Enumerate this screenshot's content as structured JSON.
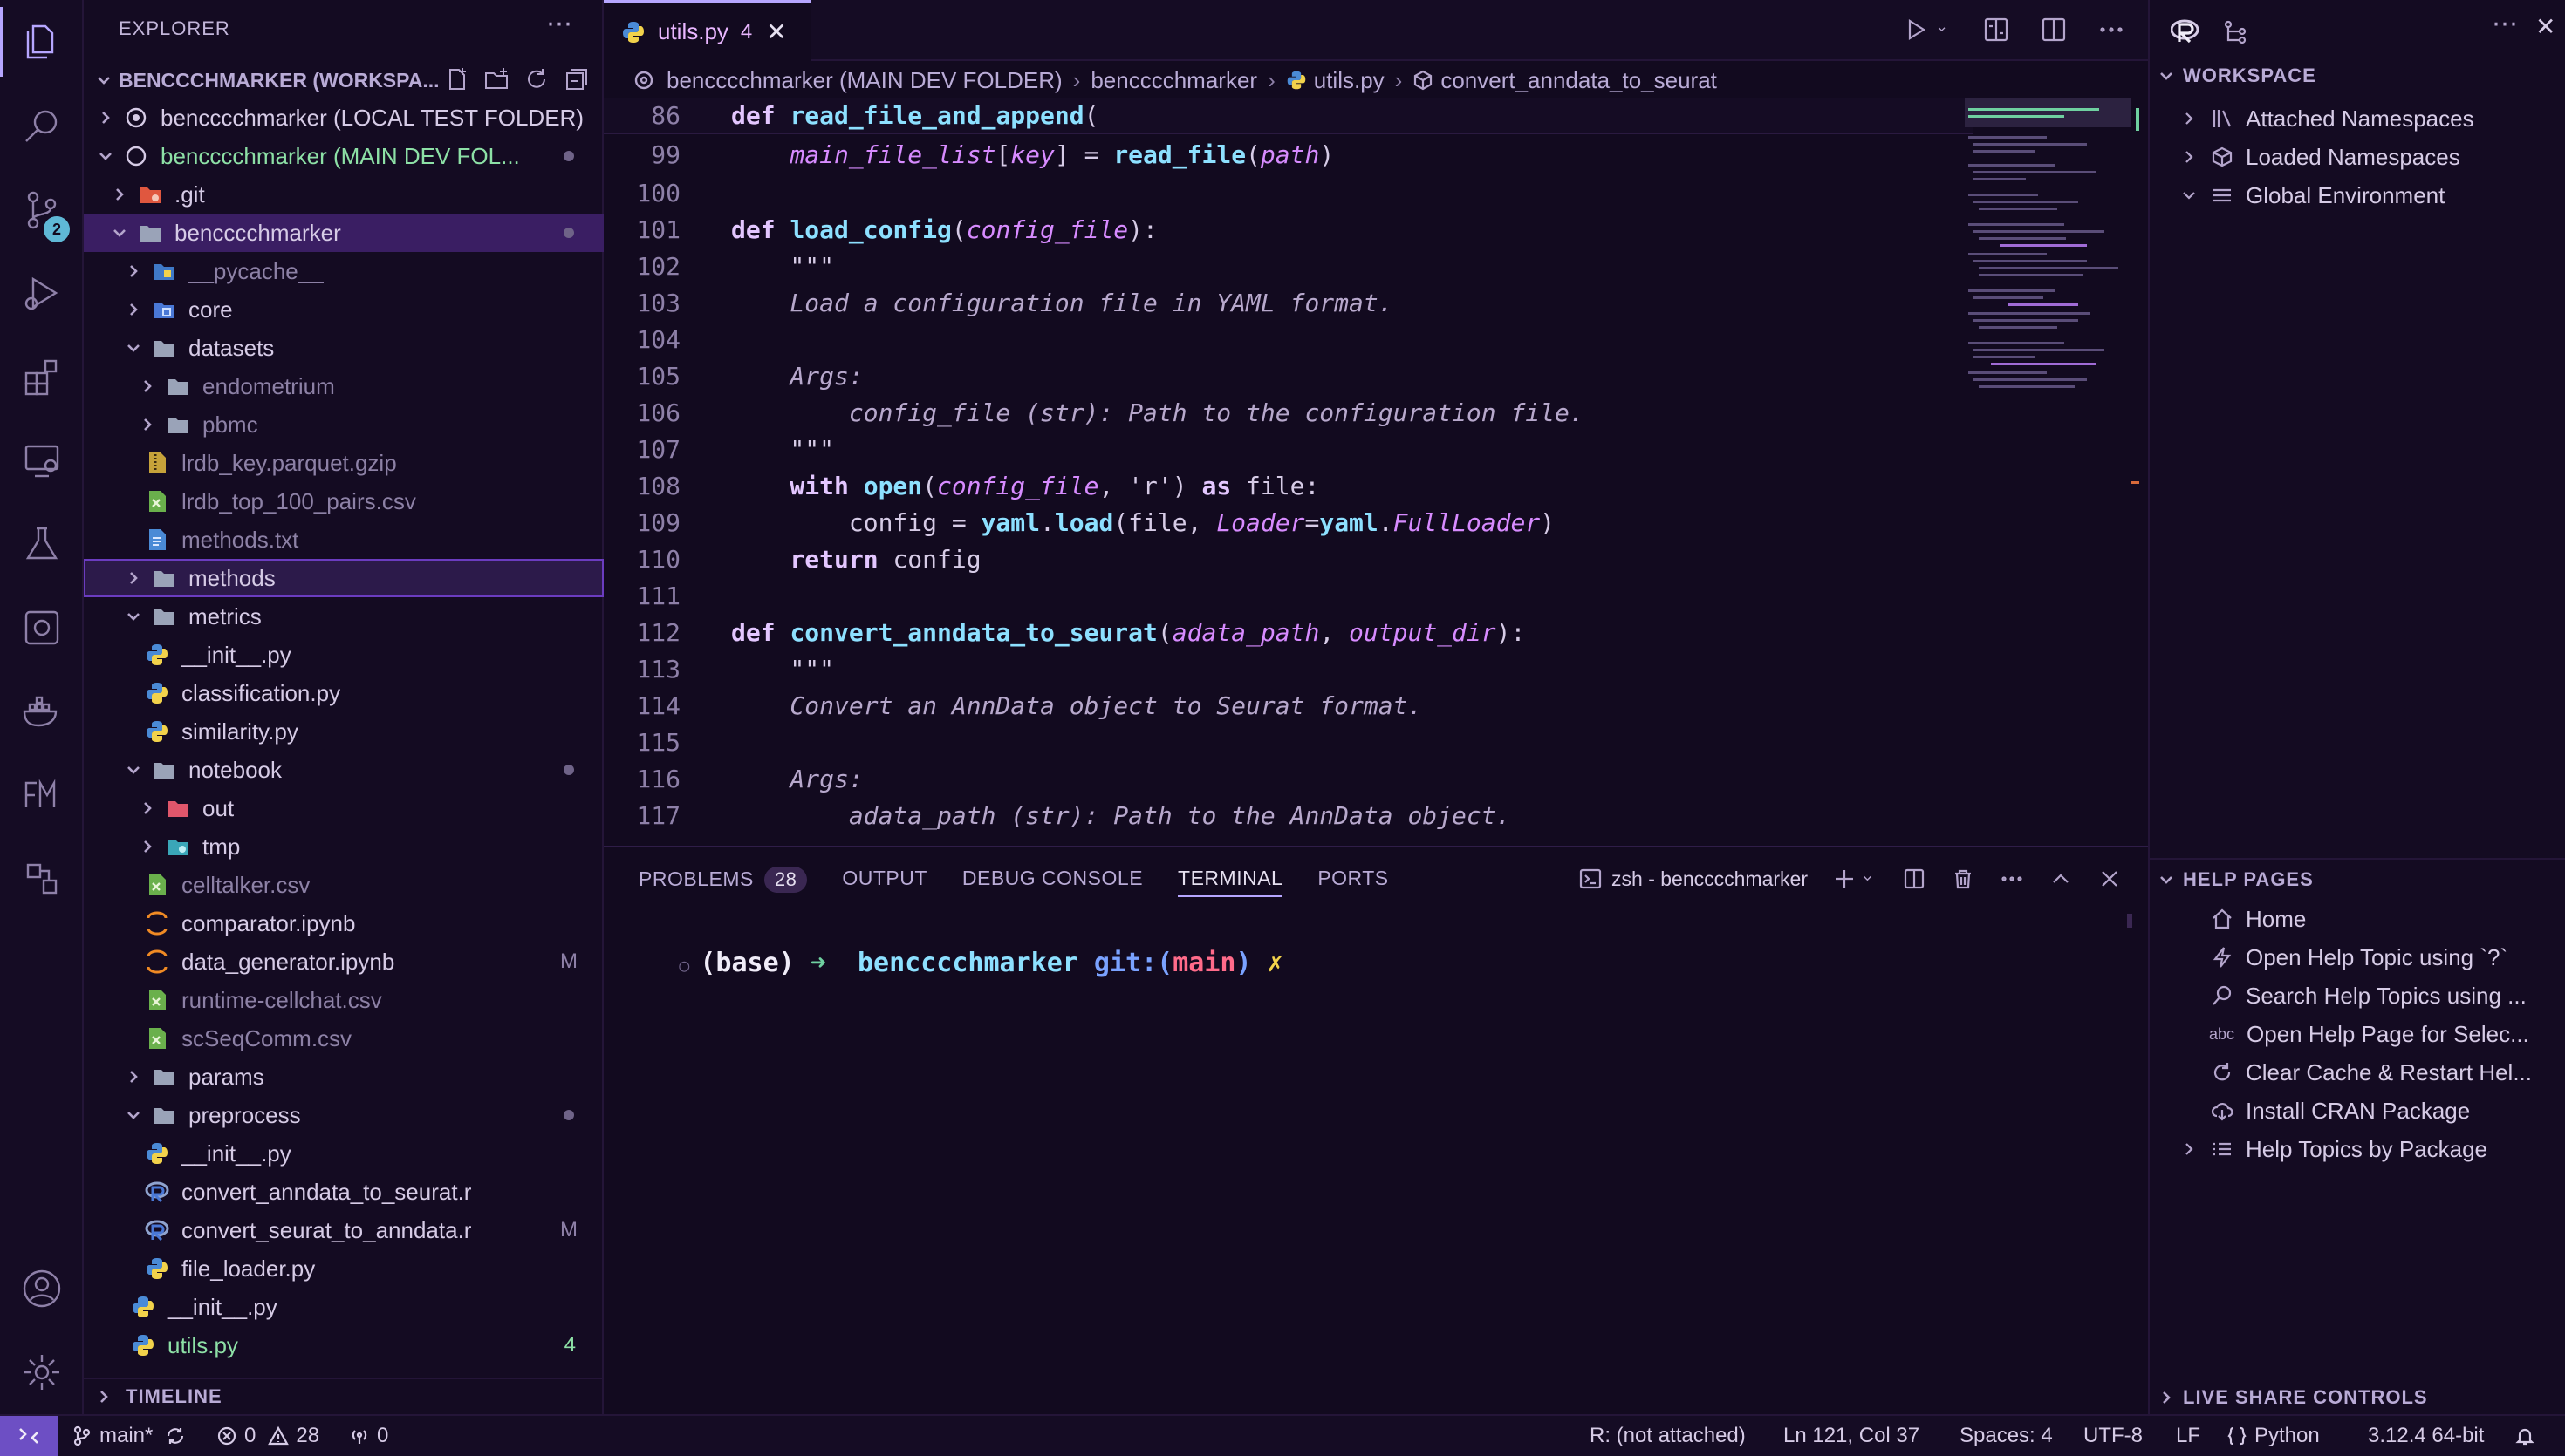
{
  "sidebar": {
    "title": "EXPLORER",
    "workspace_label": "BENCCCHMARKER (WORKSPA...",
    "tree": [
      {
        "label": "bencccchmarker (LOCAL TEST FOLDER)",
        "kind": "root",
        "indent": 0,
        "open": false
      },
      {
        "label": "bencccchmarker (MAIN DEV FOL...",
        "kind": "root",
        "indent": 0,
        "open": true,
        "green": true,
        "dot": true
      },
      {
        "label": ".git",
        "kind": "folder-git",
        "indent": 1,
        "open": false
      },
      {
        "label": "bencccchmarker",
        "kind": "folder",
        "indent": 1,
        "open": true,
        "selected": true,
        "dot": true
      },
      {
        "label": "__pycache__",
        "kind": "folder-py",
        "indent": 2,
        "open": false,
        "dim": true
      },
      {
        "label": "core",
        "kind": "folder-core",
        "indent": 2,
        "open": false
      },
      {
        "label": "datasets",
        "kind": "folder",
        "indent": 2,
        "open": true
      },
      {
        "label": "endometrium",
        "kind": "folder",
        "indent": 3,
        "open": false,
        "dim": true
      },
      {
        "label": "pbmc",
        "kind": "folder",
        "indent": 3,
        "open": false,
        "dim": true
      },
      {
        "label": "lrdb_key.parquet.gzip",
        "kind": "file-zip",
        "indent": 3,
        "dim": true
      },
      {
        "label": "lrdb_top_100_pairs.csv",
        "kind": "file-csv",
        "indent": 3,
        "dim": true
      },
      {
        "label": "methods.txt",
        "kind": "file-txt",
        "indent": 3,
        "dim": true
      },
      {
        "label": "methods",
        "kind": "folder",
        "indent": 2,
        "open": false,
        "highlight": true
      },
      {
        "label": "metrics",
        "kind": "folder",
        "indent": 2,
        "open": true
      },
      {
        "label": "__init__.py",
        "kind": "file-py",
        "indent": 3
      },
      {
        "label": "classification.py",
        "kind": "file-py",
        "indent": 3
      },
      {
        "label": "similarity.py",
        "kind": "file-py",
        "indent": 3
      },
      {
        "label": "notebook",
        "kind": "folder",
        "indent": 2,
        "open": true,
        "dot": true
      },
      {
        "label": "out",
        "kind": "folder-out",
        "indent": 3,
        "open": false
      },
      {
        "label": "tmp",
        "kind": "folder-tmp",
        "indent": 3,
        "open": false
      },
      {
        "label": "celltalker.csv",
        "kind": "file-csv",
        "indent": 3,
        "dim": true
      },
      {
        "label": "comparator.ipynb",
        "kind": "file-nb",
        "indent": 3
      },
      {
        "label": "data_generator.ipynb",
        "kind": "file-nb",
        "indent": 3,
        "deco": "M"
      },
      {
        "label": "runtime-cellchat.csv",
        "kind": "file-csv",
        "indent": 3,
        "dim": true
      },
      {
        "label": "scSeqComm.csv",
        "kind": "file-csv",
        "indent": 3,
        "dim": true
      },
      {
        "label": "params",
        "kind": "folder",
        "indent": 2,
        "open": false
      },
      {
        "label": "preprocess",
        "kind": "folder",
        "indent": 2,
        "open": true,
        "dot": true
      },
      {
        "label": "__init__.py",
        "kind": "file-py",
        "indent": 3
      },
      {
        "label": "convert_anndata_to_seurat.r",
        "kind": "file-r",
        "indent": 3
      },
      {
        "label": "convert_seurat_to_anndata.r",
        "kind": "file-r",
        "indent": 3,
        "deco": "M"
      },
      {
        "label": "file_loader.py",
        "kind": "file-py",
        "indent": 3
      },
      {
        "label": "__init__.py",
        "kind": "file-py",
        "indent": 2
      },
      {
        "label": "utils.py",
        "kind": "file-py",
        "indent": 2,
        "count": "4",
        "green": true
      }
    ],
    "timeline": "TIMELINE"
  },
  "activity": {
    "scm_badge": "2",
    "icons": [
      "files-icon",
      "search-icon",
      "source-control-icon",
      "run-debug-icon",
      "extensions-icon",
      "remote-explorer-icon",
      "testing-icon",
      "copilot-icon",
      "docker-icon",
      "fm-icon",
      "shapes-icon"
    ]
  },
  "editor": {
    "tab": {
      "label": "utils.py",
      "count": "4"
    },
    "breadcrumb": [
      "bencccchmarker (MAIN DEV FOLDER)",
      "bencccchmarker",
      "utils.py",
      "convert_anndata_to_seurat"
    ],
    "lines": [
      {
        "n": "86",
        "sticky": true,
        "tokens": [
          [
            "kw",
            "def "
          ],
          [
            "fn",
            "read_file_and_append"
          ],
          [
            "st",
            "("
          ]
        ]
      },
      {
        "n": "99",
        "tokens": [
          [
            "st",
            "    "
          ],
          [
            "pa",
            "main_file_list"
          ],
          [
            "st",
            "["
          ],
          [
            "pa",
            "key"
          ],
          [
            "st",
            "] = "
          ],
          [
            "fn",
            "read_file"
          ],
          [
            "st",
            "("
          ],
          [
            "pa",
            "path"
          ],
          [
            "st",
            ")"
          ]
        ]
      },
      {
        "n": "100",
        "tokens": []
      },
      {
        "n": "101",
        "tokens": [
          [
            "kw",
            "def "
          ],
          [
            "fn",
            "load_config"
          ],
          [
            "st",
            "("
          ],
          [
            "pa",
            "config_file"
          ],
          [
            "st",
            "):"
          ]
        ]
      },
      {
        "n": "102",
        "tokens": [
          [
            "st",
            "    \"\"\""
          ]
        ]
      },
      {
        "n": "103",
        "tokens": [
          [
            "it",
            "    Load a configuration file in YAML format."
          ]
        ]
      },
      {
        "n": "104",
        "tokens": []
      },
      {
        "n": "105",
        "tokens": [
          [
            "it",
            "    Args:"
          ]
        ]
      },
      {
        "n": "106",
        "tokens": [
          [
            "it",
            "        config_file (str): Path to the configuration file."
          ]
        ]
      },
      {
        "n": "107",
        "tokens": [
          [
            "st",
            "    \"\"\""
          ]
        ]
      },
      {
        "n": "108",
        "tokens": [
          [
            "kw",
            "    with "
          ],
          [
            "fn",
            "open"
          ],
          [
            "st",
            "("
          ],
          [
            "pa",
            "config_file"
          ],
          [
            "st",
            ", 'r') "
          ],
          [
            "kw",
            "as "
          ],
          [
            "st",
            "file:"
          ]
        ]
      },
      {
        "n": "109",
        "tokens": [
          [
            "st",
            "        config = "
          ],
          [
            "fn",
            "yaml"
          ],
          [
            "st",
            "."
          ],
          [
            "fn",
            "load"
          ],
          [
            "st",
            "(file, "
          ],
          [
            "pa",
            "Loader"
          ],
          [
            "st",
            "="
          ],
          [
            "fn",
            "yaml"
          ],
          [
            "st",
            "."
          ],
          [
            "pa",
            "FullLoader"
          ],
          [
            "st",
            ")"
          ]
        ]
      },
      {
        "n": "110",
        "tokens": [
          [
            "kw",
            "    return "
          ],
          [
            "st",
            "config"
          ]
        ]
      },
      {
        "n": "111",
        "tokens": []
      },
      {
        "n": "112",
        "tokens": [
          [
            "kw",
            "def "
          ],
          [
            "fn",
            "convert_anndata_to_seurat"
          ],
          [
            "st",
            "("
          ],
          [
            "pa",
            "adata_path"
          ],
          [
            "st",
            ", "
          ],
          [
            "pa",
            "output_dir"
          ],
          [
            "st",
            "):"
          ]
        ]
      },
      {
        "n": "113",
        "tokens": [
          [
            "st",
            "    \"\"\""
          ]
        ]
      },
      {
        "n": "114",
        "tokens": [
          [
            "it",
            "    Convert an AnnData object to Seurat format."
          ]
        ]
      },
      {
        "n": "115",
        "tokens": []
      },
      {
        "n": "116",
        "tokens": [
          [
            "it",
            "    Args:"
          ]
        ]
      },
      {
        "n": "117",
        "tokens": [
          [
            "it",
            "        adata_path (str): Path to the AnnData object."
          ]
        ]
      }
    ]
  },
  "panel": {
    "tabs": [
      "PROBLEMS",
      "OUTPUT",
      "DEBUG CONSOLE",
      "TERMINAL",
      "PORTS"
    ],
    "problems_count": "28",
    "active_tab": "TERMINAL",
    "terminal_name": "zsh - bencccchmarker",
    "prompt": {
      "env": "(base)",
      "arrow": "➜",
      "dir": "bencccchmarker",
      "git_prefix": "git:(",
      "branch": "main",
      "git_suffix": ")",
      "dirty": "✗"
    }
  },
  "right": {
    "workspace_title": "WORKSPACE",
    "workspace_items": [
      "Attached Namespaces",
      "Loaded Namespaces",
      "Global Environment"
    ],
    "help_title": "HELP PAGES",
    "help_items": [
      "Home",
      "Open Help Topic using `?`",
      "Search Help Topics using ...",
      "Open Help Page for Selec...",
      "Clear Cache & Restart Hel...",
      "Install CRAN Package",
      "Help Topics by Package"
    ],
    "live_share": "LIVE SHARE CONTROLS"
  },
  "status": {
    "branch": "main*",
    "errors": "0",
    "warnings": "28",
    "ports": "0",
    "r_status": "R: (not attached)",
    "position": "Ln 121, Col 37",
    "spaces": "Spaces: 4",
    "encoding": "UTF-8",
    "eol": "LF",
    "language": "Python",
    "interpreter": "3.12.4 64-bit"
  },
  "colors": {
    "accent": "#b6a6ff",
    "selection": "#3a1e63",
    "keyword": "#e3c6ff",
    "function": "#8de0ff",
    "param": "#d78bff"
  }
}
